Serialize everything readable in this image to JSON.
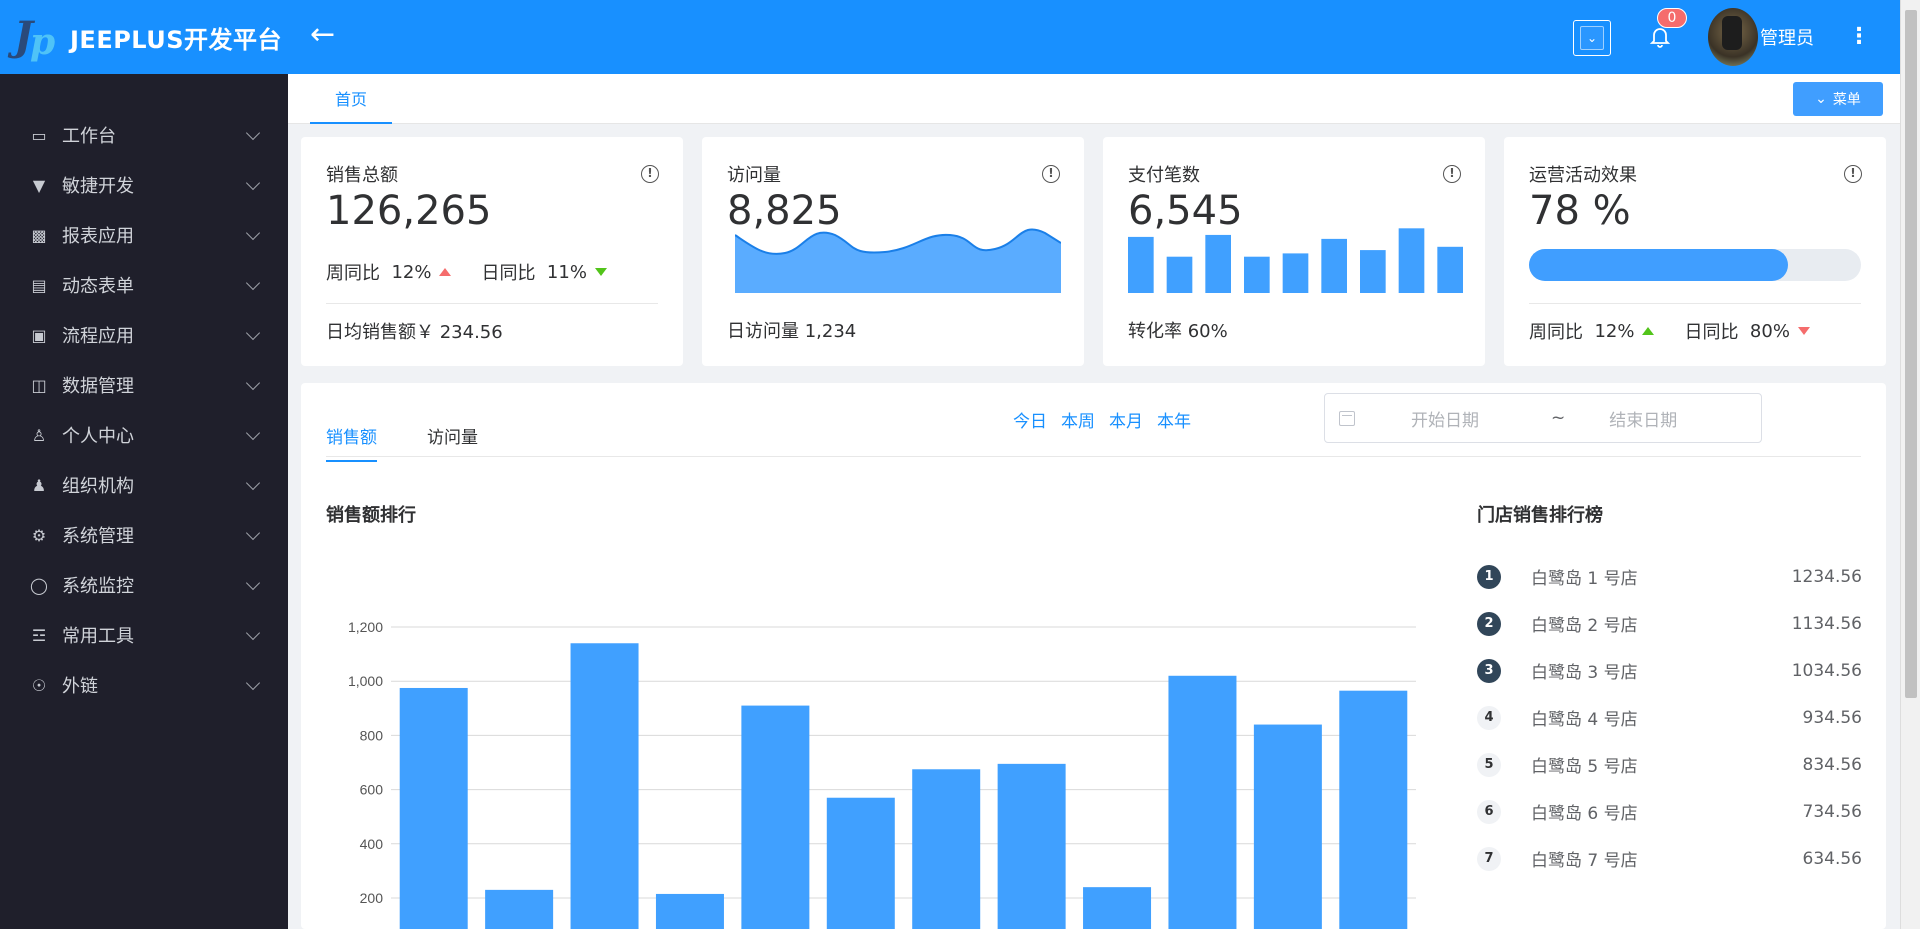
{
  "header": {
    "app_title": "JEEPLUS开发平台",
    "notification_count": "0",
    "user_name": "管理员",
    "colors": {
      "primary": "#1890ff",
      "sidebar": "#1f1f2b"
    }
  },
  "sidebar": {
    "items": [
      {
        "label": "工作台",
        "icon": "monitor-icon"
      },
      {
        "label": "敏捷开发",
        "icon": "gitlab-icon"
      },
      {
        "label": "报表应用",
        "icon": "bar-chart-icon"
      },
      {
        "label": "动态表单",
        "icon": "form-icon"
      },
      {
        "label": "流程应用",
        "icon": "cubes-icon"
      },
      {
        "label": "数据管理",
        "icon": "database-icon"
      },
      {
        "label": "个人中心",
        "icon": "user-secret-icon"
      },
      {
        "label": "组织机构",
        "icon": "org-icon"
      },
      {
        "label": "系统管理",
        "icon": "gears-icon"
      },
      {
        "label": "系统监控",
        "icon": "instagram-icon"
      },
      {
        "label": "常用工具",
        "icon": "cutlery-icon"
      },
      {
        "label": "外链",
        "icon": "ie-icon"
      }
    ]
  },
  "tabs": {
    "home": "首页",
    "menu_button": "菜单"
  },
  "cards": {
    "sales": {
      "title": "销售总额",
      "value": "126,265",
      "week_label": "周同比",
      "week_value": "12%",
      "day_label": "日同比",
      "day_value": "11%",
      "footer": "日均销售额￥ 234.56"
    },
    "visits": {
      "title": "访问量",
      "value": "8,825",
      "footer": "日访问量 1,234"
    },
    "payments": {
      "title": "支付笔数",
      "value": "6,545",
      "footer": "转化率 60%",
      "bars": [
        0.85,
        0.55,
        0.88,
        0.55,
        0.6,
        0.82,
        0.65,
        0.98,
        0.7
      ]
    },
    "operations": {
      "title": "运营活动效果",
      "value": "78 %",
      "progress": 0.78,
      "week_label": "周同比",
      "week_value": "12%",
      "day_label": "日同比",
      "day_value": "80%"
    }
  },
  "panel": {
    "tabs": [
      "销售额",
      "访问量"
    ],
    "range_links": [
      "今日",
      "本周",
      "本月",
      "本年"
    ],
    "date_start_placeholder": "开始日期",
    "date_sep": "~",
    "date_end_placeholder": "结束日期",
    "chart_title": "销售额排行",
    "ranking_title": "门店销售排行榜",
    "ranking": [
      {
        "rank": "1",
        "name": "白鹭岛 1 号店",
        "value": "1234.56"
      },
      {
        "rank": "2",
        "name": "白鹭岛 2 号店",
        "value": "1134.56"
      },
      {
        "rank": "3",
        "name": "白鹭岛 3 号店",
        "value": "1034.56"
      },
      {
        "rank": "4",
        "name": "白鹭岛 4 号店",
        "value": "934.56"
      },
      {
        "rank": "5",
        "name": "白鹭岛 5 号店",
        "value": "834.56"
      },
      {
        "rank": "6",
        "name": "白鹭岛 6 号店",
        "value": "734.56"
      },
      {
        "rank": "7",
        "name": "白鹭岛 7 号店",
        "value": "634.56"
      }
    ]
  },
  "chart_data": {
    "type": "bar",
    "title": "",
    "xlabel": "",
    "ylabel": "",
    "ylim": [
      0,
      1200
    ],
    "yticks": [
      200,
      400,
      600,
      800,
      "1,000",
      "1,200"
    ],
    "values": [
      975,
      230,
      1140,
      215,
      910,
      570,
      675,
      695,
      240,
      1020,
      840,
      965
    ],
    "grid": true,
    "color": "#40a0ff"
  }
}
